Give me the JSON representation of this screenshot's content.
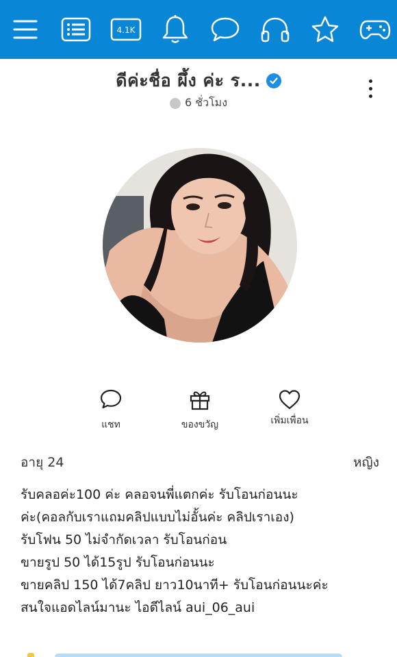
{
  "topbar": {
    "bg_color": "#0a86d6",
    "icons": [
      {
        "name": "menu-icon"
      },
      {
        "name": "list-icon"
      },
      {
        "name": "resolution-icon",
        "label": "4.1K"
      },
      {
        "name": "bell-icon"
      },
      {
        "name": "chat-bubble-icon"
      },
      {
        "name": "headphones-icon"
      },
      {
        "name": "star-icon"
      },
      {
        "name": "gamepad-icon"
      }
    ]
  },
  "profile": {
    "name": "ดีค่ะชื่อ ผึ้ง ค่ะ ร...",
    "status_text": "6 ชั่วโมง",
    "verified_color": "#1d8ee0"
  },
  "actions": {
    "chat_label": "แชท",
    "gift_label": "ของขวัญ",
    "add_friend_label": "เพิ่มเพื่อน"
  },
  "info": {
    "age_label": "อายุ 24",
    "gender_label": "หญิง"
  },
  "bio_lines": [
    "รับคลอค่ะ100 ค่ะ คลอจนพี่แตกค่ะ รับโอนก่อนนะ",
    "ค่ะ(คอลกับเราแถมคลิปแบบไม่อั้นค่ะ คลิปเราเอง)",
    "รับโฟน 50 ไม่จำกัดเวลา รับโอนก่อน",
    "ขายรูป 50 ได้15รูป รับโอนก่อนนะ",
    "ขายคลิป 150 ได้7คลิป ยาว10นาที+ รับโอนก่อนนะค่ะ",
    "สนใจแอดไลน์มานะ ไอดีไลน์ aui_06_aui"
  ]
}
